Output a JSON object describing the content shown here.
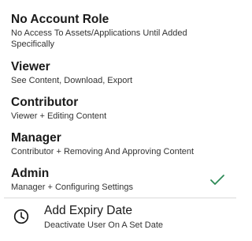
{
  "roles": [
    {
      "title": "No Account Role",
      "description": "No Access To Assets/Applications Until Added Specifically",
      "selected": false
    },
    {
      "title": "Viewer",
      "description": "See Content, Download, Export",
      "selected": false
    },
    {
      "title": "Contributor",
      "description": "Viewer + Editing Content",
      "selected": false
    },
    {
      "title": "Manager",
      "description": "Contributor + Removing And Approving Content",
      "selected": false
    },
    {
      "title": "Admin",
      "description": "Manager + Configuring Settings",
      "selected": true
    }
  ],
  "expiry": {
    "title": "Add Expiry Date",
    "description": "Deactivate User On A Set Date",
    "icon": "clock-icon"
  },
  "colors": {
    "check": "#2e8b57",
    "divider": "#d9d9d9"
  }
}
